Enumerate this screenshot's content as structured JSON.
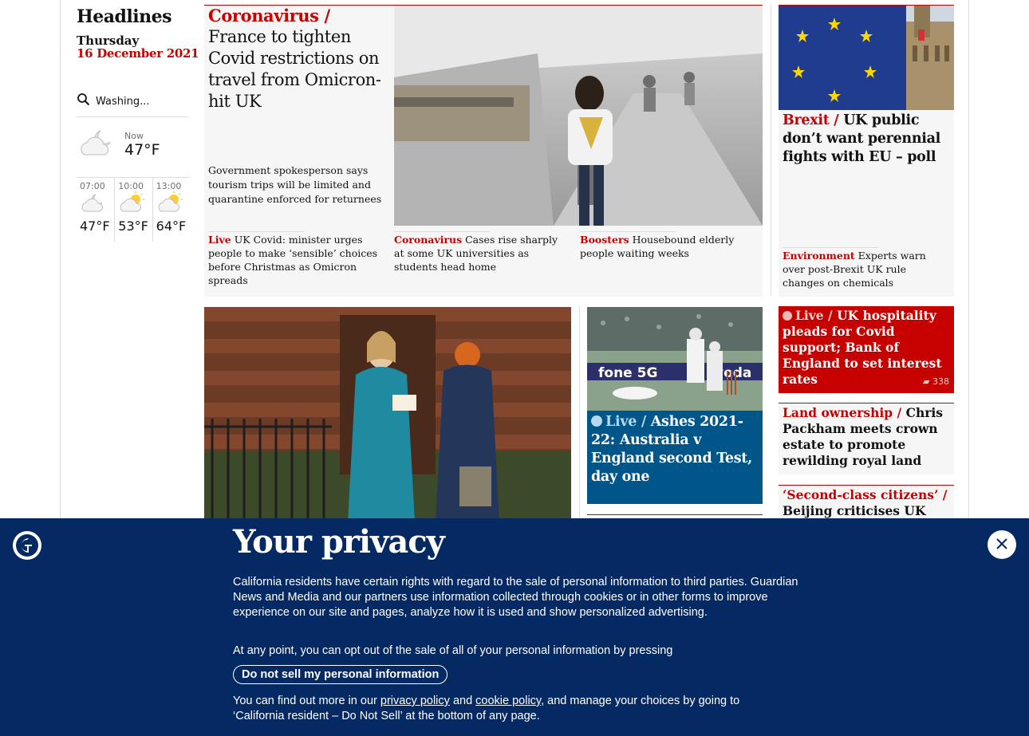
{
  "headlines": {
    "section_title": "Headlines",
    "day": "Thursday",
    "date": "16 December 2021"
  },
  "weather": {
    "location": "Washing...",
    "now_label": "Now",
    "now_temp": "47°F",
    "forecast": [
      {
        "time": "07:00",
        "temp": "47°F",
        "icon": "moon-cloud-icon"
      },
      {
        "time": "10:00",
        "temp": "53°F",
        "icon": "sun-cloud-icon"
      },
      {
        "time": "13:00",
        "temp": "64°F",
        "icon": "sun-cloud-icon"
      }
    ]
  },
  "lead": {
    "kicker": "Coronavirus /",
    "headline": "France to tighten Covid restrictions on travel from Omicron-hit UK",
    "trail": "Government spokesperson says tourism trips will be limited and quarantine enforced for returnees"
  },
  "sublinks": [
    {
      "kicker": "Live",
      "text": "UK Covid: minister urges people to make ‘sensible’ choices before Christmas as Omicron spreads"
    },
    {
      "kicker": "Coronavirus",
      "text": "Cases rise sharply at some UK universities as students head home"
    },
    {
      "kicker": "Boosters",
      "text": "Housebound elderly people waiting weeks"
    }
  ],
  "brexit": {
    "kicker": "Brexit /",
    "headline": "UK public don’t want perennial fights with EU – poll",
    "sub_kicker": "Environment",
    "sub_text": "Experts warn over post-Brexit UK rule changes on chemicals"
  },
  "live_hospitality": {
    "kicker": "Live /",
    "headline": "UK hospitality pleads for Covid support; Bank of England to set interest rates",
    "comments": "338"
  },
  "land": {
    "kicker": "Land ownership /",
    "headline": "Chris Packham meets crown estate to promote rewilding royal land"
  },
  "beijing": {
    "kicker": "‘Second-class citizens’ /",
    "headline": "Beijing criticises UK over"
  },
  "ashes": {
    "kicker": "Live /",
    "headline": "Ashes 2021-22: Australia v England second Test, day one"
  },
  "privacy": {
    "title": "Your privacy",
    "body": "California residents have certain rights with regard to the sale of personal information to third parties. Guardian News and Media and our partners use information collected through cookies or in other forms to improve experience on our site and pages, analyze how it is used and show personalized advertising.",
    "optout": "At any point, you can opt out of the sale of all of your personal information by pressing",
    "button": "Do not sell my personal information",
    "more_prefix": "You can find out more in our",
    "privacy_link": "privacy policy",
    "and": "and",
    "cookie_link": "cookie policy",
    "more_suffix": ", and manage your choices by going to ‘California resident – Do Not Sell’ at the bottom of any page."
  }
}
